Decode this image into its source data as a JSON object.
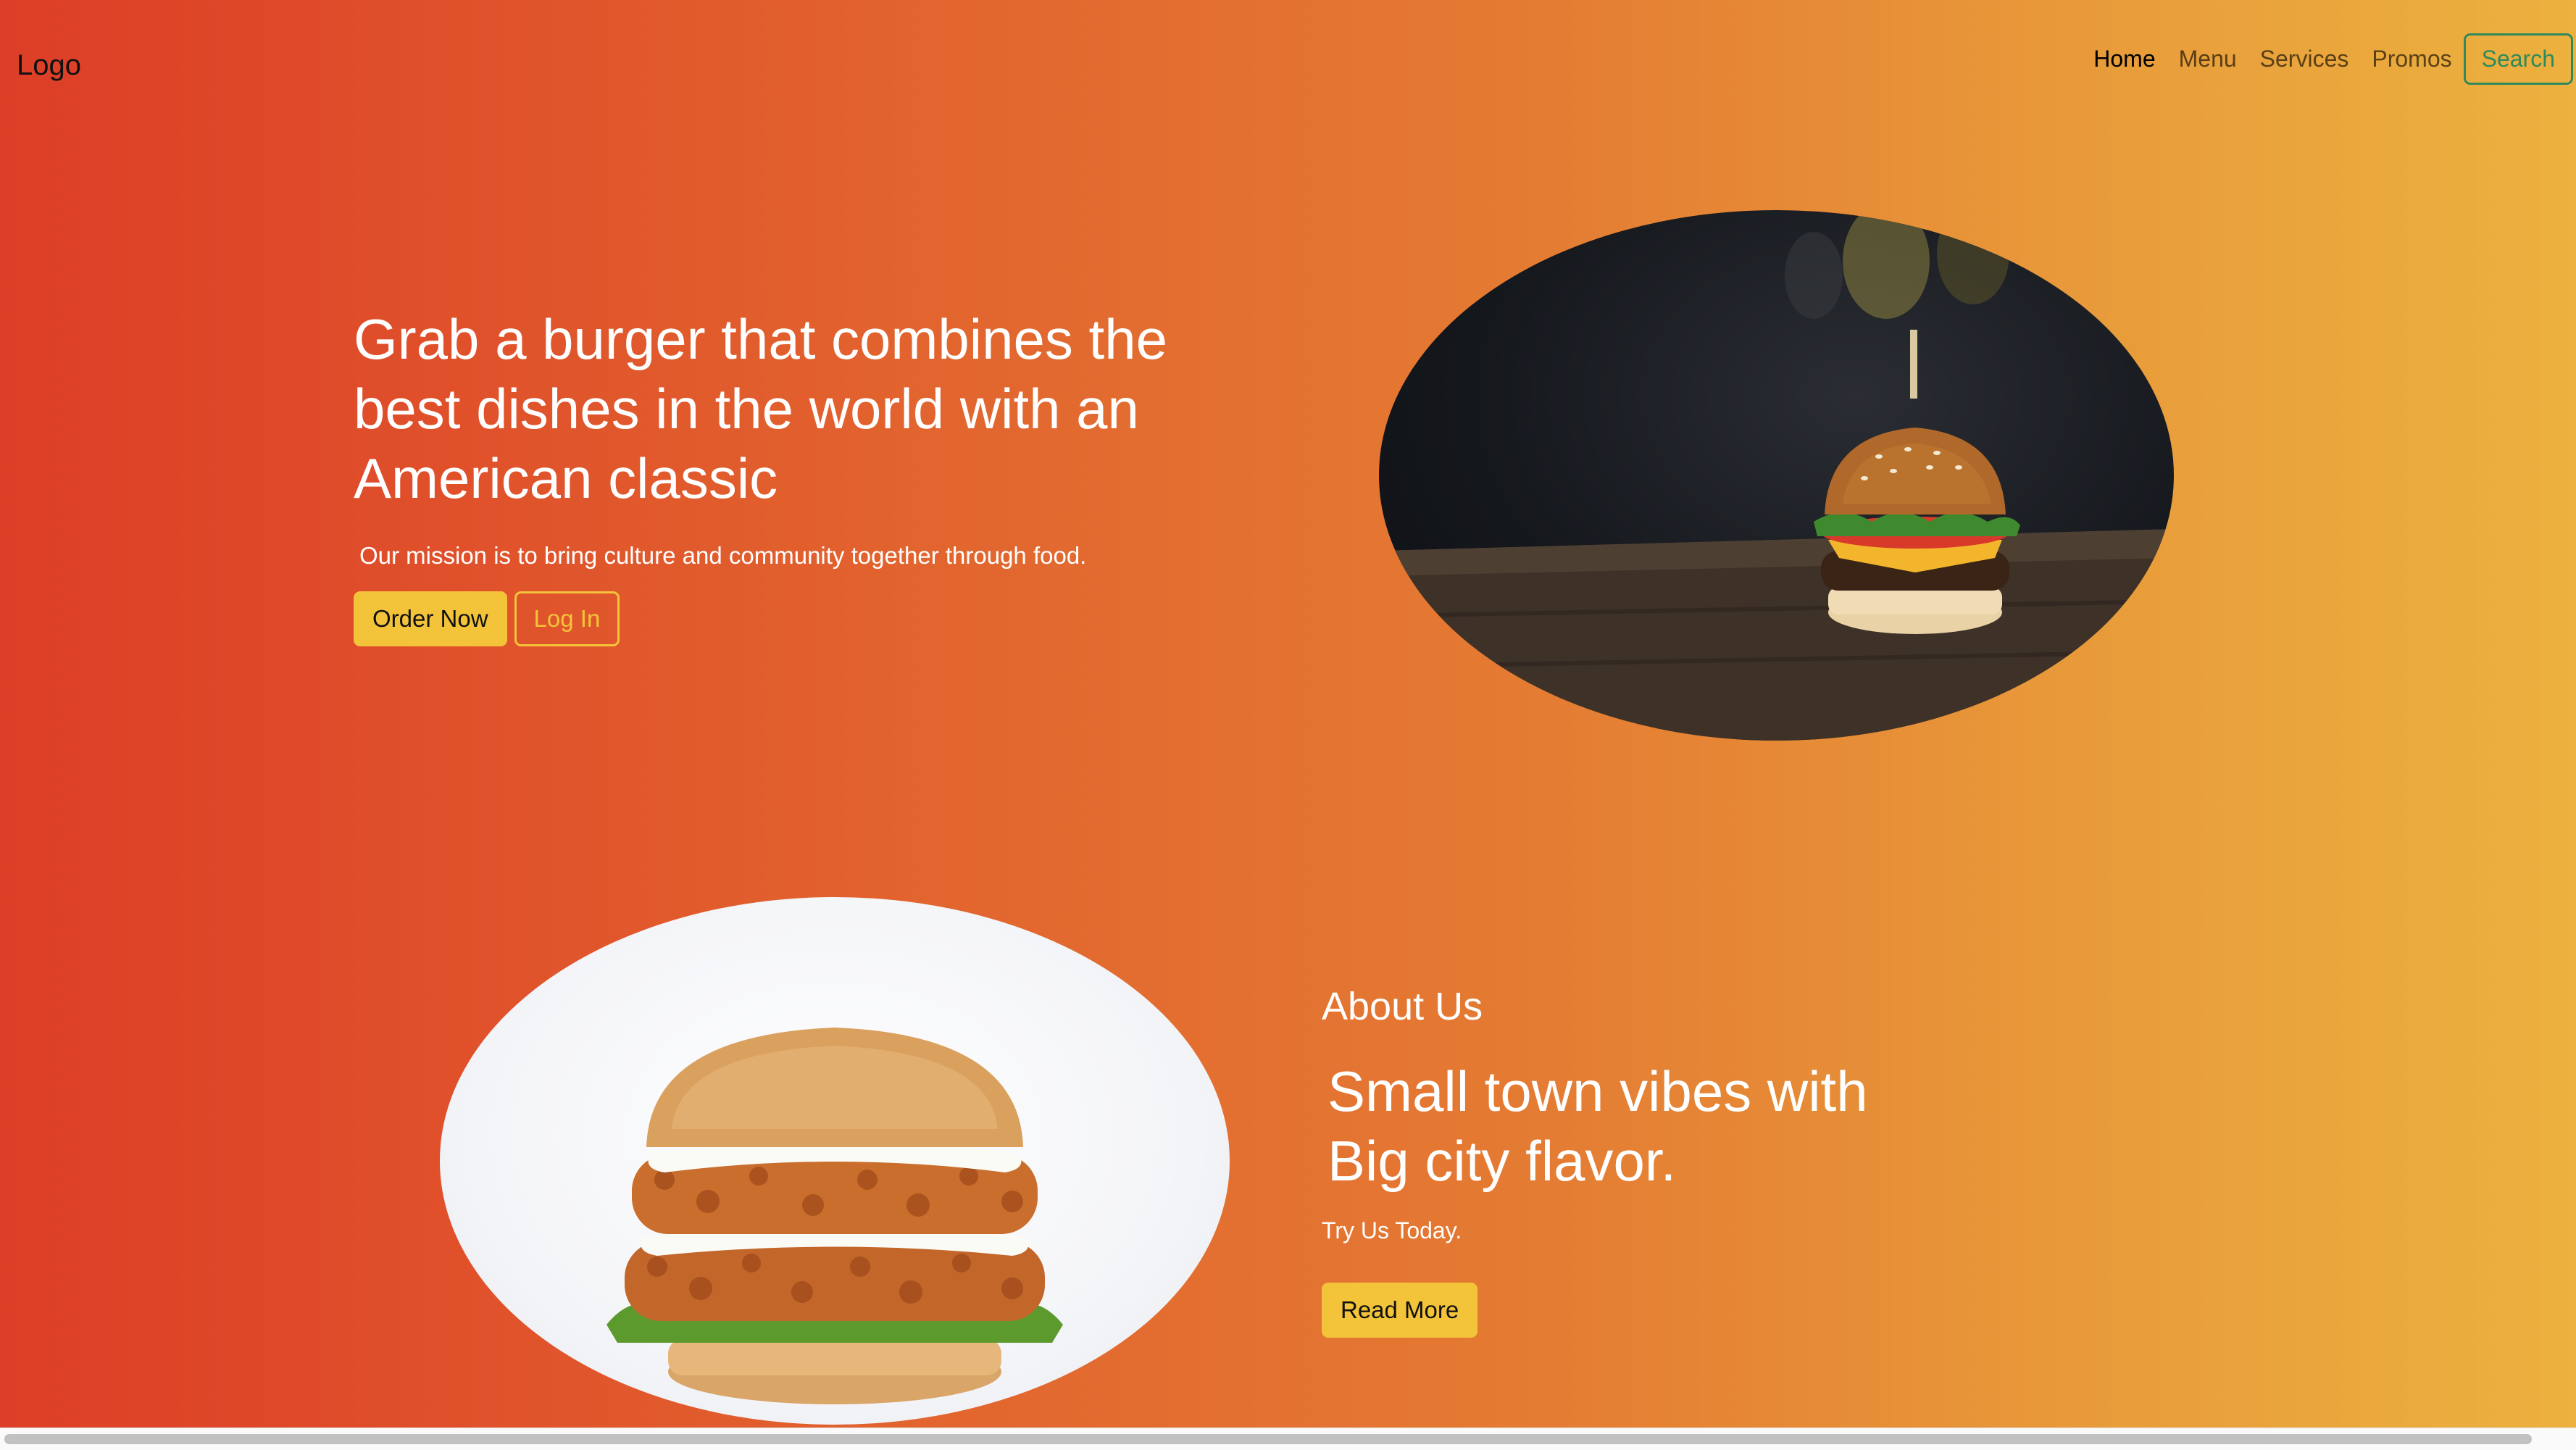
{
  "header": {
    "logo": "Logo",
    "nav": [
      {
        "label": "Home",
        "active": true
      },
      {
        "label": "Menu",
        "active": false
      },
      {
        "label": "Services",
        "active": false
      },
      {
        "label": "Promos",
        "active": false
      }
    ],
    "search_label": "Search"
  },
  "hero": {
    "title": "Grab a burger that combines the best dishes in the world with an American classic",
    "text": "Our mission is to bring culture and community together through food.",
    "order_label": "Order Now",
    "login_label": "Log In",
    "image": "burger-photo-dark"
  },
  "about": {
    "label": "About Us",
    "title_line1": "Small town vibes with",
    "title_line2": "Big city flavor.",
    "text": "Try Us Today.",
    "read_more_label": "Read More",
    "image": "chicken-burger-photo"
  },
  "colors": {
    "gradient_start": "#dd3e27",
    "gradient_end": "#ecb13f",
    "button_yellow": "#f3c43a",
    "search_green": "#2f8a5b"
  }
}
